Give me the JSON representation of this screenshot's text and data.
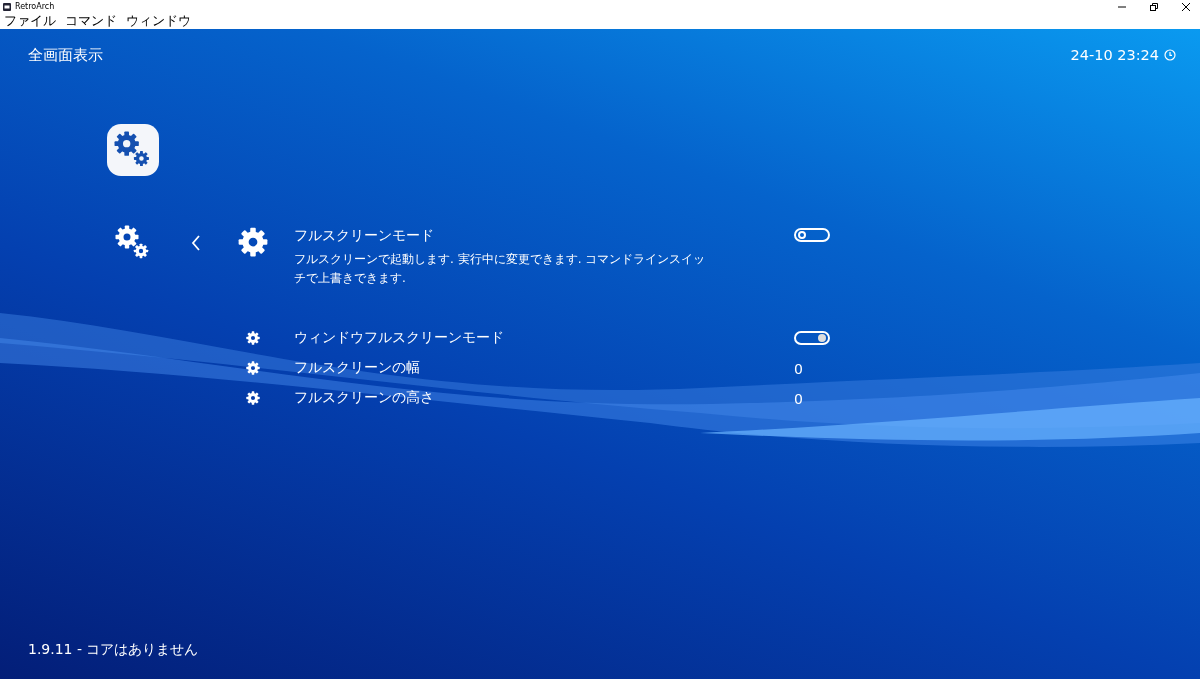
{
  "window": {
    "title": "RetroArch"
  },
  "menu": [
    "ファイル",
    "コマンド",
    "ウィンドウ"
  ],
  "header": {
    "title": "全画面表示",
    "clock": "24-10 23:24"
  },
  "items": [
    {
      "kind": "toggle",
      "label": "フルスクリーンモード",
      "description": "フルスクリーンで起動します. 実行中に変更できます. コマンドラインスイッチで上書きできます.",
      "on": false,
      "selected": true
    },
    {
      "kind": "toggle",
      "label": "ウィンドウフルスクリーンモード",
      "on": true,
      "selected": false
    },
    {
      "kind": "value",
      "label": "フルスクリーンの幅",
      "value": "0",
      "selected": false
    },
    {
      "kind": "value",
      "label": "フルスクリーンの高さ",
      "value": "0",
      "selected": false
    }
  ],
  "footer": "1.9.11 - コアはありません"
}
